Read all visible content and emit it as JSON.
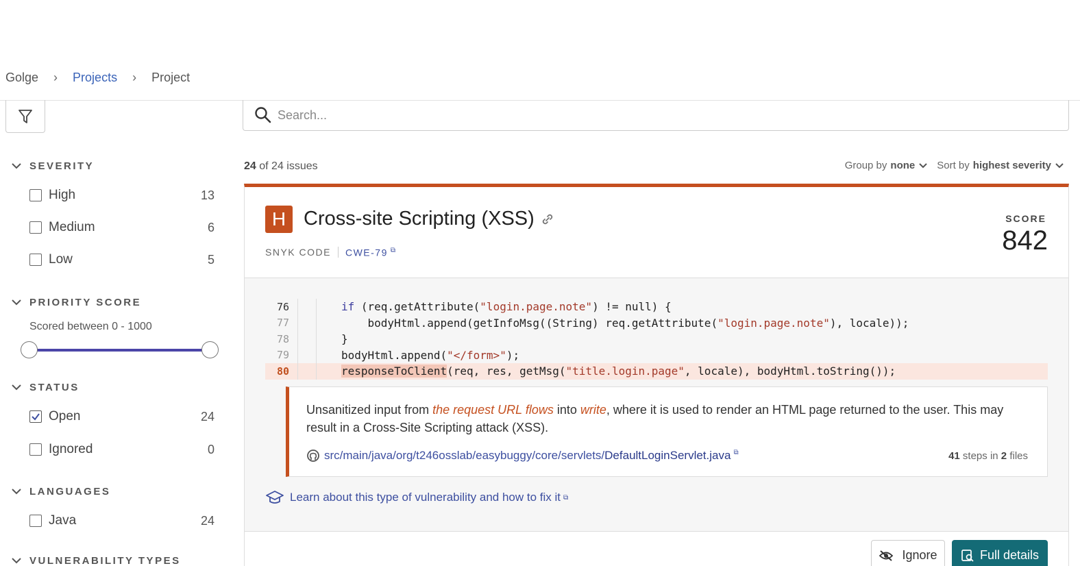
{
  "breadcrumb": {
    "org": "Golge",
    "projects": "Projects",
    "project": "Project"
  },
  "search": {
    "placeholder": "Search..."
  },
  "sidebar": {
    "severity": {
      "title": "SEVERITY",
      "items": [
        {
          "label": "High",
          "count": "13",
          "checked": false
        },
        {
          "label": "Medium",
          "count": "6",
          "checked": false
        },
        {
          "label": "Low",
          "count": "5",
          "checked": false
        }
      ]
    },
    "priority": {
      "title": "PRIORITY SCORE",
      "range_text": "Scored between 0 - 1000",
      "min": 0,
      "max": 1000
    },
    "status": {
      "title": "STATUS",
      "items": [
        {
          "label": "Open",
          "count": "24",
          "checked": true
        },
        {
          "label": "Ignored",
          "count": "0",
          "checked": false
        }
      ]
    },
    "languages": {
      "title": "LANGUAGES",
      "items": [
        {
          "label": "Java",
          "count": "24",
          "checked": false
        }
      ]
    },
    "vuln_types": {
      "title": "VULNERABILITY TYPES"
    }
  },
  "list": {
    "shown": "24",
    "of_text": "of 24 issues",
    "group_label": "Group by",
    "group_value": "none",
    "sort_label": "Sort by",
    "sort_value": "highest severity"
  },
  "issue": {
    "severity_letter": "H",
    "title": "Cross-site Scripting (XSS)",
    "source": "SNYK CODE",
    "cwe": "CWE-79",
    "score_label": "SCORE",
    "score": "842",
    "code": [
      {
        "ln": "76",
        "indent": "",
        "parts": [
          [
            "kw",
            "if"
          ],
          [
            "p",
            " (req.getAttribute("
          ],
          [
            "str",
            "\"login.page.note\""
          ],
          [
            "p",
            ") != null) {"
          ]
        ]
      },
      {
        "ln": "77",
        "indent": "    ",
        "parts": [
          [
            "p",
            "bodyHtml.append(getInfoMsg((String) req.getAttribute("
          ],
          [
            "str",
            "\"login.page.note\""
          ],
          [
            "p",
            "), locale));"
          ]
        ]
      },
      {
        "ln": "78",
        "indent": "",
        "parts": [
          [
            "p",
            "}"
          ]
        ]
      },
      {
        "ln": "79",
        "indent": "",
        "parts": [
          [
            "p",
            "bodyHtml.append("
          ],
          [
            "str",
            "\"</form>\""
          ],
          [
            "p",
            ");"
          ]
        ]
      },
      {
        "ln": "80",
        "indent": "",
        "parts": [
          [
            "mark",
            "responseToClient"
          ],
          [
            "p",
            "(req, res, getMsg("
          ],
          [
            "str",
            "\"title.login.page\""
          ],
          [
            "p",
            ", locale), bodyHtml.toString());"
          ]
        ]
      }
    ],
    "explain": {
      "pre": "Unsanitized input from ",
      "source_em": "the request URL flows",
      "mid": " into ",
      "sink_em": "write",
      "post": ", where it is used to render an HTML page returned to the user. This may result in a Cross-Site Scripting attack (XSS)."
    },
    "path_dir": "src/main/java/org/t246osslab/easybuggy/core/servlets/",
    "path_file": "DefaultLoginServlet.java",
    "steps": "41",
    "steps_text": "steps in",
    "files": "2",
    "files_text": "files",
    "learn_text": "Learn about this type of vulnerability and how to fix it",
    "ignore_label": "Ignore",
    "full_details_label": "Full details"
  },
  "colors": {
    "severity_high": "#c5501f",
    "accent": "#3d4fa0",
    "primary_button": "#146b76"
  }
}
